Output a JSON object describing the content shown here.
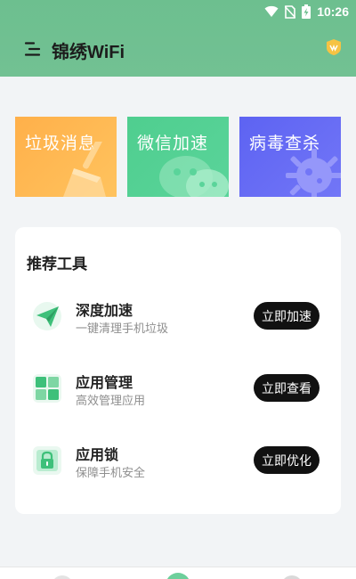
{
  "status_bar": {
    "time": "10:26",
    "icons": [
      "wifi-icon",
      "no-sim-icon",
      "battery-charging-icon"
    ]
  },
  "header": {
    "title": "锦绣WiFi",
    "menu_icon": "menu-icon",
    "vip_icon": "vip-badge-icon"
  },
  "feature_cards": [
    {
      "label": "垃圾消息",
      "icon": "broom-icon",
      "color": "#ffb04a"
    },
    {
      "label": "微信加速",
      "icon": "wechat-icon",
      "color": "#4fce8f"
    },
    {
      "label": "病毒查杀",
      "icon": "virus-icon",
      "color": "#5d63f2"
    }
  ],
  "tools": {
    "title": "推荐工具",
    "items": [
      {
        "name": "深度加速",
        "desc": "一键清理手机垃圾",
        "button": "立即加速",
        "icon": "paper-plane-icon"
      },
      {
        "name": "应用管理",
        "desc": "高效管理应用",
        "button": "立即查看",
        "icon": "app-grid-icon"
      },
      {
        "name": "应用锁",
        "desc": "保障手机安全",
        "button": "立即优化",
        "icon": "lock-icon"
      }
    ]
  },
  "colors": {
    "header": "#6dbf8f",
    "accent_green": "#3ec07a",
    "button": "#111111"
  }
}
